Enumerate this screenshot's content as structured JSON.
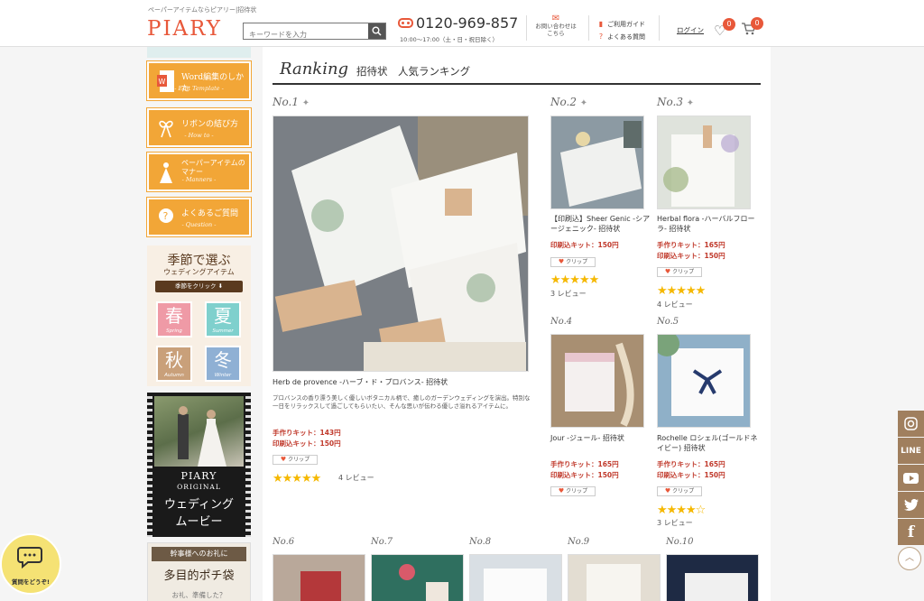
{
  "header": {
    "tagline": "ペーパーアイテムならピアリー|招待状",
    "logo": "PIARY",
    "search_placeholder": "キーワードを入力",
    "phone": "0120-969-857",
    "hours": "10:00〜17:00（土・日・祝日除く）",
    "contact_label": "お問い合わせは こちら",
    "guide_label": "ご利用ガイド",
    "faq_label": "よくある質問",
    "login_label": "ログイン",
    "favorites_count": "0",
    "cart_count": "0",
    "accent_color": "#e8583a"
  },
  "sidebar": {
    "word_btn": {
      "title": "Word編集のしかた",
      "sub": "- Edit Template -"
    },
    "ribbon_btn": {
      "title": "リボンの結び方",
      "sub": "- How to -"
    },
    "manners_btn": {
      "title": "ペーパーアイテムのマナー",
      "sub": "- Manners -"
    },
    "faq_btn": {
      "title": "よくあるご質問",
      "sub": "- Question -"
    },
    "season": {
      "title1": "季節で選ぶ",
      "title2": "ウェディングアイテム",
      "click": "季節をクリック",
      "items": [
        {
          "kanji": "春",
          "en": "Spring",
          "color": "#ef9aa6"
        },
        {
          "kanji": "夏",
          "en": "Summer",
          "color": "#7fd0cd"
        },
        {
          "kanji": "秋",
          "en": "Autumn",
          "color": "#c9a07a"
        },
        {
          "kanji": "冬",
          "en": "Winter",
          "color": "#8fb0d4"
        }
      ]
    },
    "movie": {
      "brand": "PIARY",
      "sub": "ORIGINAL",
      "title1": "ウェディング",
      "title2": "ムービー"
    },
    "petit": {
      "head": "幹事様へのお礼に",
      "body": "多目的ポチ袋",
      "foot": "お礼、準備した？"
    }
  },
  "ranking": {
    "script": "Ranking",
    "title": "招待状　人気ランキング",
    "items": [
      {
        "no": "No.1",
        "title": "Herb de provence -ハーブ・ド・プロバンス- 招待状",
        "desc": "プロバンスの香り漂う美しく優しいボタニカル柄で、癒しのガーデンウェディングを演出。特別な一日をリラックスして過ごしてもらいたい、そんな思いが伝わる優しさ溢れるアイテムに。",
        "price1": "手作りキット：143円",
        "price2": "印刷込キット：150円",
        "clip": "クリップ",
        "stars": "★★★★★",
        "reviews": "4 レビュー"
      },
      {
        "no": "No.2",
        "title": "【印刷込】Sheer Genic -シアージェニック- 招待状",
        "price1": "印刷込キット：150円",
        "clip": "クリップ",
        "stars": "★★★★★",
        "reviews": "3 レビュー"
      },
      {
        "no": "No.3",
        "title": "Herbal flora -ハーバルフローラ- 招待状",
        "price1": "手作りキット：165円",
        "price2": "印刷込キット：150円",
        "clip": "クリップ",
        "stars": "★★★★★",
        "reviews": "4 レビュー"
      },
      {
        "no": "No.4",
        "title": "Jour -ジュール- 招待状",
        "price1": "手作りキット：165円",
        "price2": "印刷込キット：150円",
        "clip": "クリップ"
      },
      {
        "no": "No.5",
        "title": "Rochelle ロシェル(ゴールドネイビー) 招待状",
        "price1": "手作りキット：165円",
        "price2": "印刷込キット：150円",
        "clip": "クリップ",
        "stars": "★★★★☆",
        "reviews": "3 レビュー"
      },
      {
        "no": "No.6"
      },
      {
        "no": "No.7"
      },
      {
        "no": "No.8"
      },
      {
        "no": "No.9"
      },
      {
        "no": "No.10"
      }
    ]
  },
  "social": [
    "Instagram",
    "LINE",
    "YouTube",
    "Twitter",
    "Facebook"
  ],
  "chat": {
    "label": "質問をどうぞ!"
  }
}
